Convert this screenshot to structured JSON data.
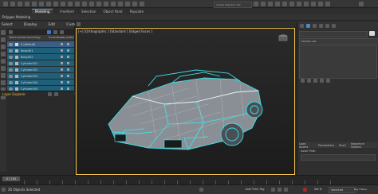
{
  "app": {
    "workspace_label": "Workspace: Design Standard",
    "selection_set": "Create Selection Set"
  },
  "ribbon": {
    "tabs": [
      "Modeling",
      "Freeform",
      "Selection",
      "Object Paint",
      "Populate"
    ],
    "active_tab": "Modeling",
    "subtitle": "Polygon Modeling"
  },
  "scene_explorer": {
    "menu": [
      "Select",
      "Display",
      "Edit",
      "Customize"
    ],
    "header_name": "Name (Sorted Ascending)",
    "header_frozen": "Frozen",
    "header_display": "Display as Box",
    "rows": [
      "0 (default)",
      "Body001",
      "Body002",
      "Cylinder001",
      "Cylinder002",
      "Cylinder003",
      "Cylinder004",
      "Cylinder005"
    ],
    "footer_label": "Layer Explorer"
  },
  "viewport": {
    "label": "[+] [Orthographic ] [Standard ] [Edged Faces ]"
  },
  "command_panel": {
    "modifier_list": "Modifier List",
    "bottom_tabs": [
      "Load Assets",
      "Parameters",
      "Shell",
      "Sequence Options"
    ],
    "asset_path_label": "Asset Path:"
  },
  "timeline": {
    "frame_readout": "0 / 100"
  },
  "status": {
    "objects_selected": "26 Objects Selected",
    "add_time_tag": "Add Time Tag",
    "selected_label": "Selected",
    "set_key_label": "Set K.",
    "key_filters_label": "Key Filters..."
  },
  "colors": {
    "wire_cyan": "#3fe0e6",
    "accent_blue": "#2f7fcf",
    "explorer_label": "#e6c13a"
  }
}
